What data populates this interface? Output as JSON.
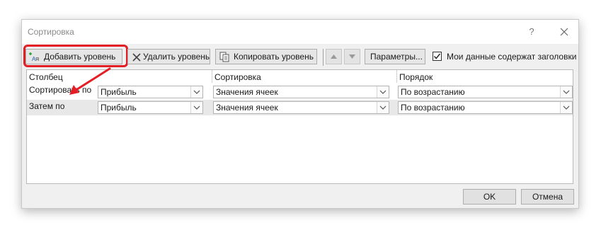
{
  "window": {
    "title": "Сортировка",
    "help_label": "?",
    "accent_color": "#e31e24"
  },
  "toolbar": {
    "add_level_label": "Добавить уровень",
    "delete_level_label": "Удалить уровень",
    "copy_level_label": "Копировать уровень",
    "params_label": "Параметры...",
    "has_headers_label": "Мои данные содержат заголовки",
    "has_headers_checked": true
  },
  "grid": {
    "columns": [
      "Столбец",
      "Сортировка",
      "Порядок"
    ],
    "rows": [
      {
        "label": "Сортировать по",
        "column": "Прибыль",
        "sort_on": "Значения ячеек",
        "order": "По возрастанию"
      },
      {
        "label": "Затем по",
        "column": "Прибыль",
        "sort_on": "Значения ячеек",
        "order": "По возрастанию"
      }
    ]
  },
  "footer": {
    "ok_label": "OK",
    "cancel_label": "Отмена"
  }
}
